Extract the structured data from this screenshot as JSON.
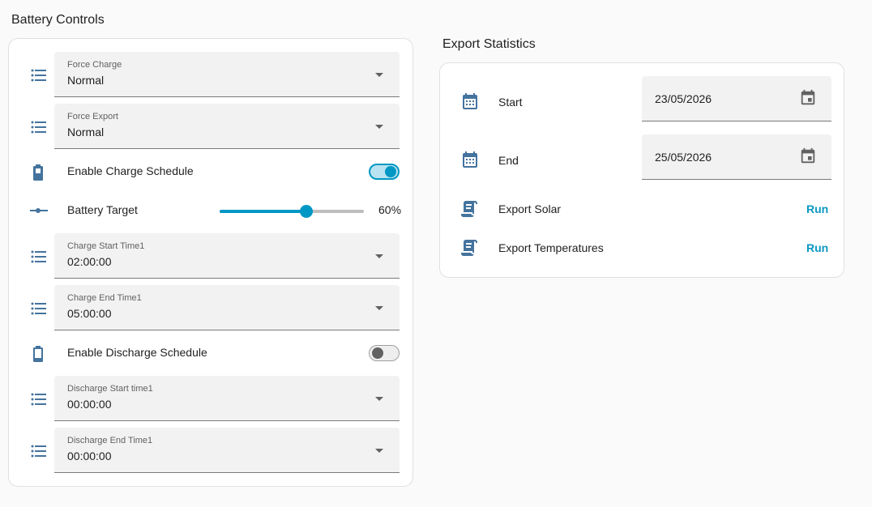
{
  "battery_controls": {
    "title": "Battery Controls",
    "force_charge": {
      "label": "Force Charge",
      "value": "Normal",
      "icon": "format-list-icon"
    },
    "force_export": {
      "label": "Force Export",
      "value": "Normal",
      "icon": "format-list-icon"
    },
    "enable_charge_schedule": {
      "label": "Enable Charge Schedule",
      "state": "on",
      "icon": "battery-icon"
    },
    "battery_target": {
      "label": "Battery Target",
      "value": 60,
      "display": "60%",
      "icon": "slider-icon"
    },
    "charge_start_time": {
      "label": "Charge Start Time1",
      "value": "02:00:00"
    },
    "charge_end_time": {
      "label": "Charge End Time1",
      "value": "05:00:00"
    },
    "enable_discharge_schedule": {
      "label": "Enable Discharge Schedule",
      "state": "off",
      "icon": "battery-low-icon"
    },
    "discharge_start_time": {
      "label": "Discharge Start time1",
      "value": "00:00:00"
    },
    "discharge_end_time": {
      "label": "Discharge End Time1",
      "value": "00:00:00"
    }
  },
  "export_statistics": {
    "title": "Export Statistics",
    "start": {
      "label": "Start",
      "value": "23/05/2026",
      "icon": "calendar-icon"
    },
    "end": {
      "label": "End",
      "value": "25/05/2026",
      "icon": "calendar-icon"
    },
    "export_solar": {
      "label": "Export Solar",
      "action": "Run",
      "icon": "script-icon"
    },
    "export_temperatures": {
      "label": "Export Temperatures",
      "action": "Run",
      "icon": "script-icon"
    }
  },
  "colors": {
    "icon": "#44739e",
    "accent": "#0097c4",
    "field_bg": "#f2f2f2"
  }
}
